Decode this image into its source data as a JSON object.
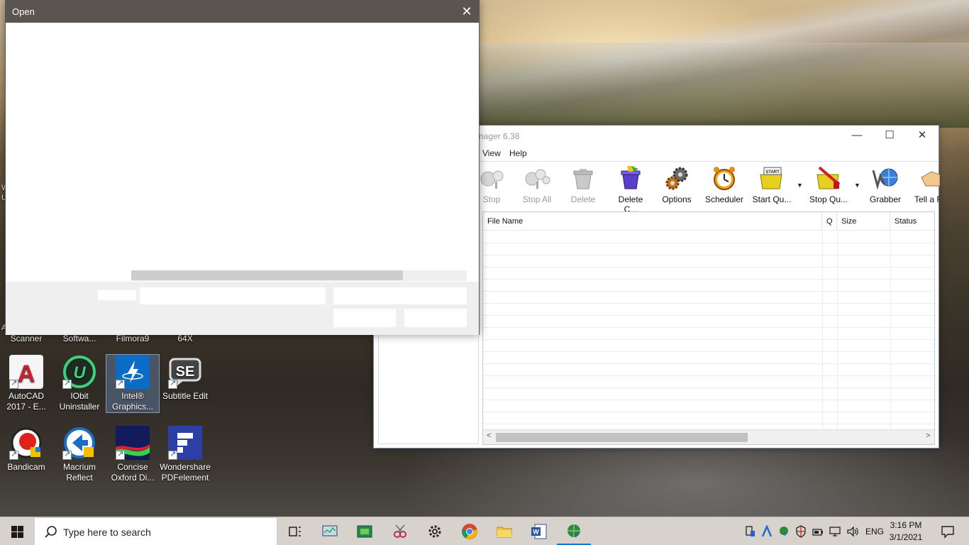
{
  "desktop": {
    "partial_labels": [
      "Scanner",
      "Softwa...",
      "Filmora9",
      "64X"
    ],
    "edge_text": [
      "W",
      "U",
      "A"
    ],
    "icons": [
      {
        "label_line1": "AutoCAD",
        "label_line2": "2017 - E...",
        "icon": "autocad-icon"
      },
      {
        "label_line1": "IObit",
        "label_line2": "Uninstaller",
        "icon": "iobit-uninstaller-icon"
      },
      {
        "label_line1": "Intel®",
        "label_line2": "Graphics...",
        "icon": "intel-graphics-icon"
      },
      {
        "label_line1": "Subtitle Edit",
        "label_line2": "",
        "icon": "subtitle-edit-icon"
      },
      {
        "label_line1": "Bandicam",
        "label_line2": "",
        "icon": "bandicam-icon"
      },
      {
        "label_line1": "Macrium",
        "label_line2": "Reflect",
        "icon": "macrium-reflect-icon"
      },
      {
        "label_line1": "Concise",
        "label_line2": "Oxford Di...",
        "icon": "oxford-dictionary-icon"
      },
      {
        "label_line1": "Wondershare",
        "label_line2": "PDFelement",
        "icon": "pdfelement-icon"
      }
    ]
  },
  "open_dialog": {
    "title": "Open",
    "close_glyph": "✕"
  },
  "idm": {
    "title": "nager 6.38",
    "win_controls": {
      "minimize": "—",
      "maximize": "☐",
      "close": "✕"
    },
    "menu": [
      "View",
      "Help"
    ],
    "toolbar": [
      {
        "label": "Stop",
        "icon": "stop-icon",
        "enabled": false
      },
      {
        "label": "Stop All",
        "icon": "stop-all-icon",
        "enabled": false
      },
      {
        "label": "Delete",
        "icon": "delete-icon",
        "enabled": false
      },
      {
        "label": "Delete C...",
        "icon": "delete-completed-icon",
        "enabled": true
      },
      {
        "label": "Options",
        "icon": "options-gear-icon",
        "enabled": true
      },
      {
        "label": "Scheduler",
        "icon": "scheduler-clock-icon",
        "enabled": true
      },
      {
        "label": "Start Qu...",
        "icon": "start-queue-icon",
        "enabled": true
      },
      {
        "label": "Stop Qu...",
        "icon": "stop-queue-icon",
        "enabled": true
      },
      {
        "label": "Grabber",
        "icon": "grabber-icon",
        "enabled": true
      },
      {
        "label": "Tell a Fr",
        "icon": "tell-a-friend-icon",
        "enabled": true
      }
    ],
    "dropdown_glyph": "▼",
    "columns": [
      "File Name",
      "Q",
      "Size",
      "Status"
    ],
    "scroll_left": "<",
    "scroll_right": ">"
  },
  "taskbar": {
    "search_placeholder": "Type here to search",
    "apps": [
      "task-view-icon",
      "monitor-app-icon",
      "green-app-icon",
      "snipping-tool-icon",
      "settings-gear-icon",
      "chrome-icon",
      "file-explorer-icon",
      "word-icon",
      "idm-globe-icon"
    ],
    "tray": {
      "language": "ENG"
    },
    "clock": {
      "time": "3:16 PM",
      "date": "3/1/2021"
    },
    "colors": {
      "accent": "#0078d7",
      "taskbar": "#d7d2cc"
    }
  }
}
